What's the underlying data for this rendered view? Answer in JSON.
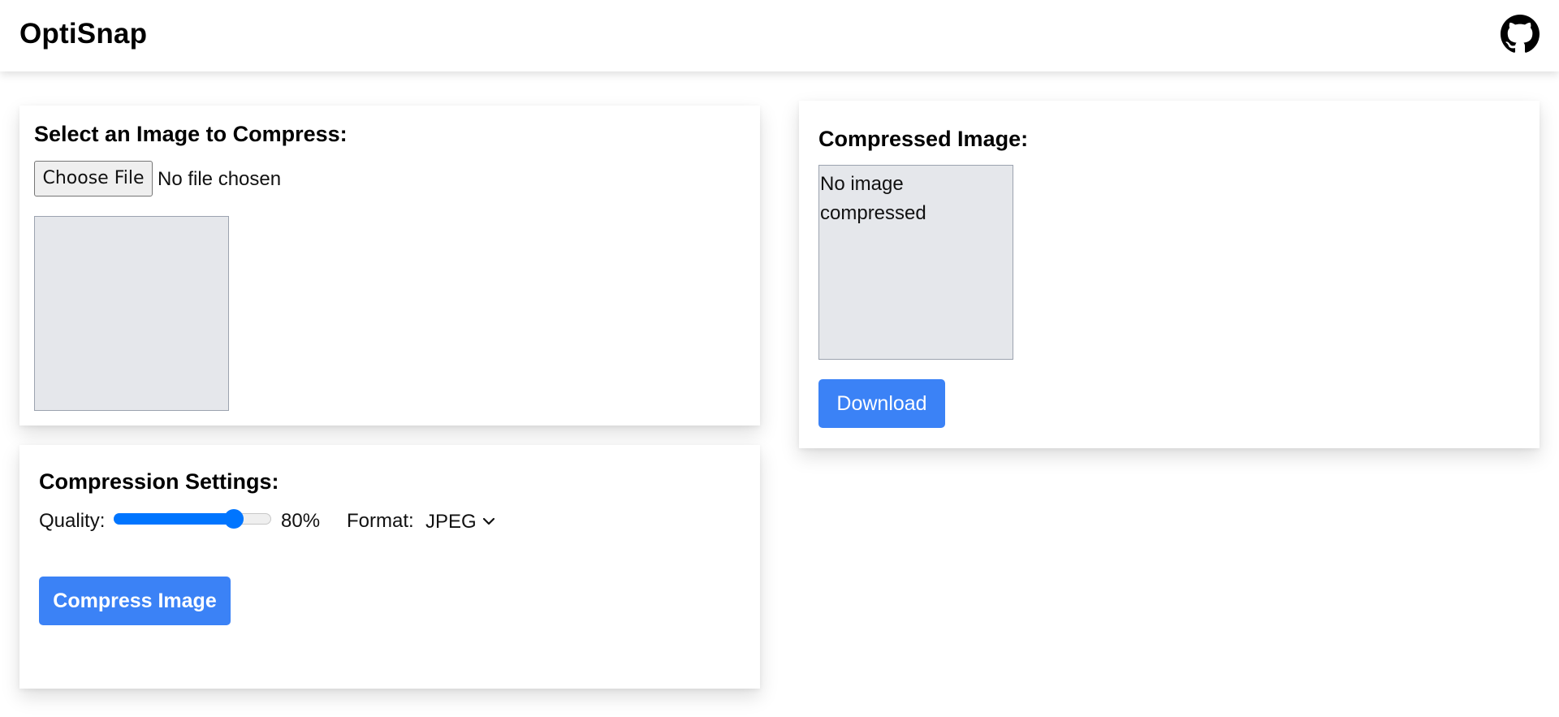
{
  "header": {
    "brand": "OptiSnap",
    "github_icon": "github-icon"
  },
  "select_card": {
    "title": "Select an Image to Compress:",
    "file_button_label": "Choose File",
    "file_status": "No file chosen"
  },
  "settings_card": {
    "title": "Compression Settings:",
    "quality_label": "Quality:",
    "quality_value": 80,
    "quality_display": "80%",
    "format_label": "Format:",
    "format_selected": "JPEG",
    "compress_label": "Compress Image"
  },
  "output_card": {
    "title": "Compressed Image:",
    "placeholder": "No image compressed",
    "download_label": "Download"
  },
  "colors": {
    "accent": "#3b82f6",
    "slider_accent": "#0075ff",
    "preview_bg": "#e5e7eb",
    "preview_border": "#9ca3af"
  }
}
